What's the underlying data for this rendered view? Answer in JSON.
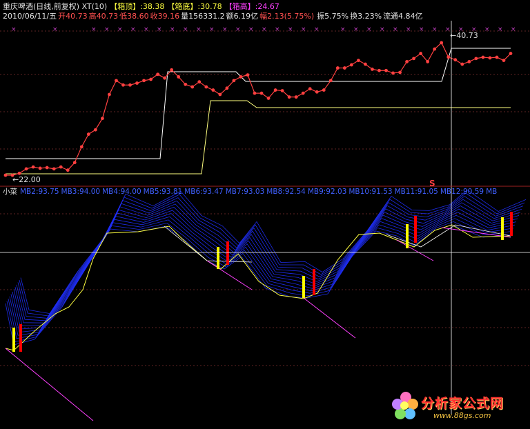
{
  "header": {
    "name_line": "重庆啤酒(日线,前复权) XT(10)",
    "box_top_label": "【箱顶】",
    "box_top_value": ":38.38",
    "box_bottom_label": "【箱底】",
    "box_bottom_value": ":30.78",
    "box_high_label": "【箱高】",
    "box_high_value": ":24.67",
    "date": "2010/06/11/五",
    "open": "开40.73",
    "high": "高40.73",
    "low": "低38.60",
    "close": "收39.16",
    "volume": "量156331.2",
    "amount": "额6.19亿",
    "change": "幅2.13(5.75%)",
    "amplitude": "振5.75%",
    "turnover": "换3.23%",
    "float": "流通4.84亿"
  },
  "lower_header": {
    "name": "小菜",
    "items": [
      "MB2:93.75",
      "MB3:94.00",
      "MB4:94.00",
      "MB5:93.81",
      "MB6:93.47",
      "MB7:93.03",
      "MB8:92.54",
      "MB9:92.03",
      "MB10:91.53",
      "MB11:91.05",
      "MB12:90.59",
      "MB"
    ]
  },
  "chart_data": [
    {
      "type": "line",
      "title": "重庆啤酒(日线,前复权)",
      "x": [
        1,
        2,
        3,
        4,
        5,
        6,
        7,
        8,
        9,
        10,
        11,
        12,
        13,
        14,
        15,
        16,
        17,
        18,
        19,
        20,
        21,
        22,
        23,
        24,
        25,
        26,
        27,
        28,
        29,
        30,
        31,
        32,
        33,
        34,
        35,
        36,
        37,
        38,
        39,
        40,
        41,
        42,
        43,
        44,
        45,
        46,
        47,
        48,
        49,
        50,
        51,
        52,
        53,
        54,
        55,
        56,
        57,
        58,
        59,
        60,
        61,
        62
      ],
      "series": [
        {
          "values": [
            22.0,
            22.0,
            22.3,
            23.0,
            23.3,
            23.1,
            23.2,
            23.0,
            23.3,
            22.8,
            24.0,
            26.5,
            28.5,
            29.2,
            31.0,
            34.8,
            37.0,
            36.3,
            36.3,
            36.6,
            37.0,
            37.2,
            38.0,
            37.4,
            38.7,
            37.6,
            36.4,
            36.0,
            36.8,
            36.0,
            35.5,
            34.8,
            35.8,
            37.0,
            37.6,
            37.9,
            35.0,
            35.0,
            34.2,
            35.5,
            35.4,
            34.4,
            34.4,
            35.0,
            35.7,
            35.2,
            35.5,
            37.0,
            39.0,
            39.0,
            39.5,
            40.2,
            39.6,
            38.8,
            38.6,
            38.6,
            38.2,
            38.3,
            40.0,
            40.5,
            41.3,
            40.0,
            42.0,
            43.0,
            40.73,
            40.3,
            39.6,
            40.0,
            40.5,
            40.7,
            40.6,
            40.7,
            40.2,
            41.3
          ]
        }
      ],
      "annotations": [
        {
          "text": "←22.00",
          "x": 2,
          "y": 22.0
        },
        {
          "text": "←40.73",
          "x": 62,
          "y": 43.0
        },
        {
          "text": "S",
          "x": 52
        }
      ]
    },
    {
      "type": "line",
      "title": "小菜",
      "series": [
        {
          "name": "MB2",
          "values": [
            93.75
          ]
        },
        {
          "name": "MB3",
          "values": [
            94.0
          ]
        },
        {
          "name": "MB4",
          "values": [
            94.0
          ]
        },
        {
          "name": "MB5",
          "values": [
            93.81
          ]
        },
        {
          "name": "MB6",
          "values": [
            93.47
          ]
        },
        {
          "name": "MB7",
          "values": [
            93.03
          ]
        },
        {
          "name": "MB8",
          "values": [
            92.54
          ]
        },
        {
          "name": "MB9",
          "values": [
            92.03
          ]
        },
        {
          "name": "MB10",
          "values": [
            91.53
          ]
        },
        {
          "name": "MB11",
          "values": [
            91.05
          ]
        },
        {
          "name": "MB12",
          "values": [
            90.59
          ]
        }
      ]
    }
  ],
  "colors": {
    "price_line": "#ff4040",
    "box_top": "#ffffff",
    "box_bottom": "#ffff80",
    "ribbon": "#2030ff",
    "fast_line": "#ffff40",
    "diag": "#ff40ff",
    "bar_yellow": "#ffff00",
    "bar_red": "#ff0000",
    "grid": "#803030",
    "marker": "#c040c0"
  },
  "watermark": {
    "text": "分析家公式网",
    "url": "www.88gs.com"
  }
}
